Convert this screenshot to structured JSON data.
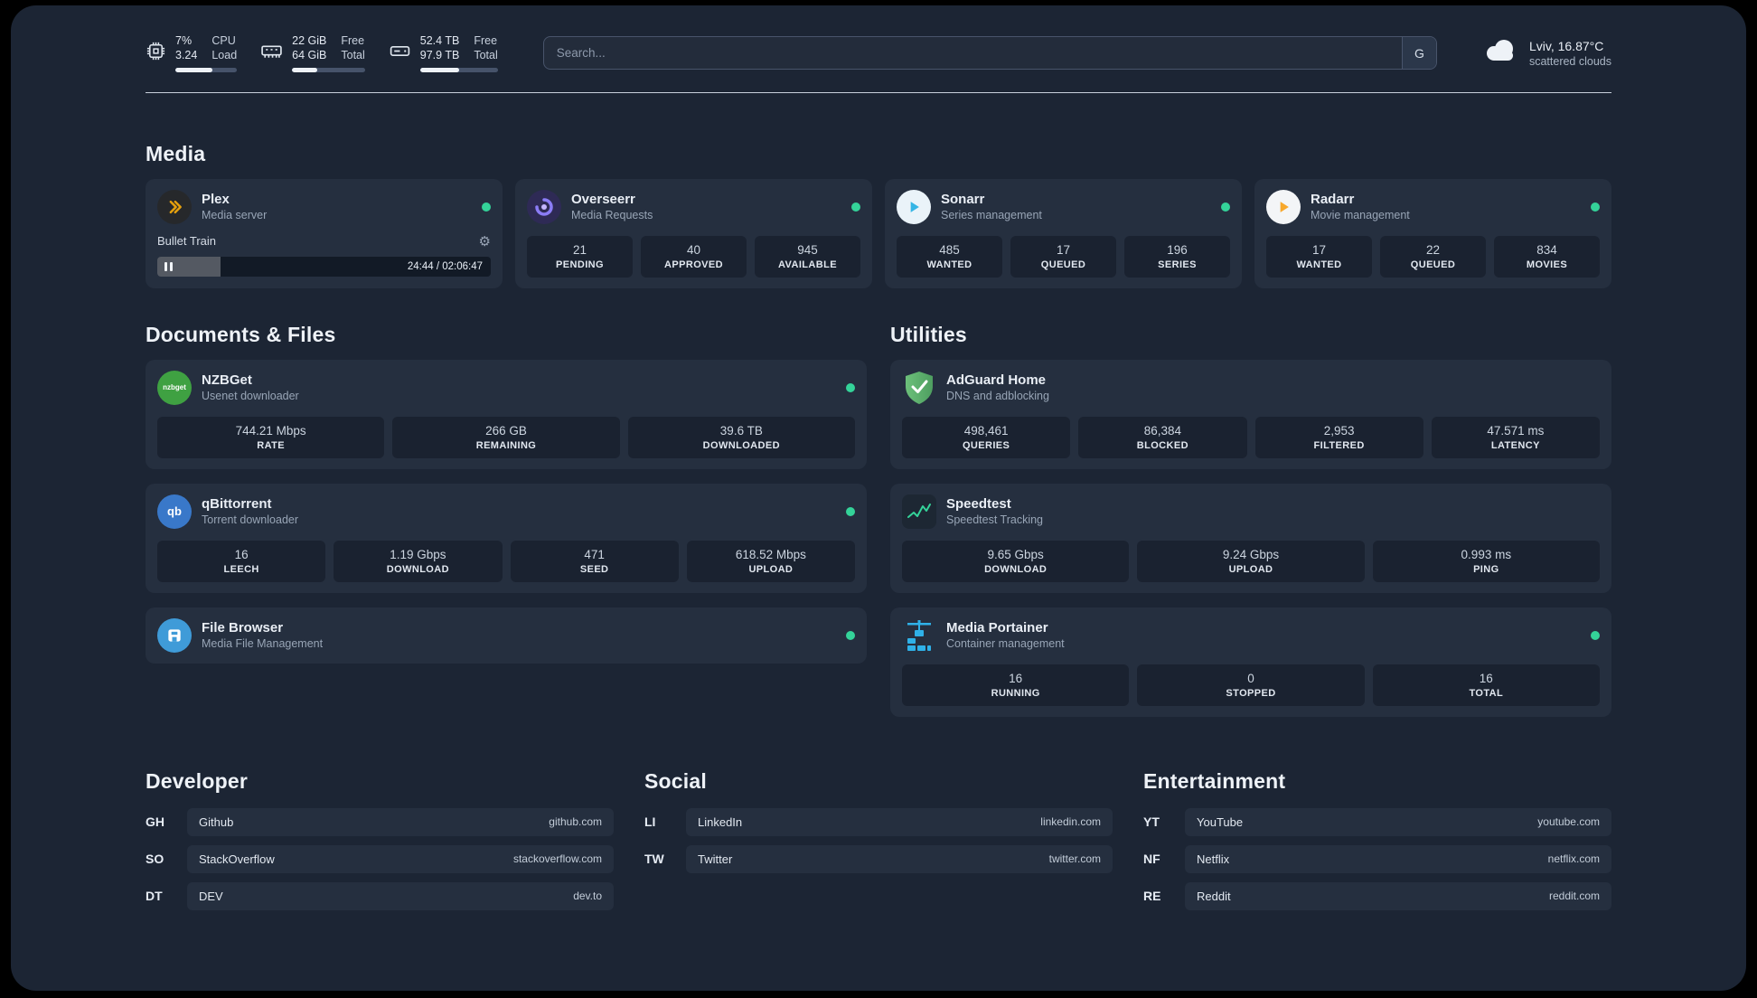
{
  "topbar": {
    "cpu": {
      "percent": "7%",
      "load": "3.24",
      "label_top": "CPU",
      "label_bottom": "Load",
      "bar_pct": 60
    },
    "ram": {
      "free": "22 GiB",
      "total": "64 GiB",
      "free_label": "Free",
      "total_label": "Total",
      "bar_pct": 35
    },
    "disk": {
      "free": "52.4 TB",
      "total": "97.9 TB",
      "free_label": "Free",
      "total_label": "Total",
      "bar_pct": 50
    },
    "search": {
      "placeholder": "Search...",
      "provider_letter": "G"
    },
    "weather": {
      "location": "Lviv, 16.87°C",
      "condition": "scattered clouds"
    }
  },
  "sections": {
    "media": {
      "title": "Media",
      "cards": {
        "plex": {
          "name": "Plex",
          "subtitle": "Media server",
          "now_playing": "Bullet Train",
          "time": "24:44 / 02:06:47",
          "progress_pct": 19
        },
        "overseerr": {
          "name": "Overseerr",
          "subtitle": "Media Requests",
          "stats": [
            {
              "value": "21",
              "label": "PENDING"
            },
            {
              "value": "40",
              "label": "APPROVED"
            },
            {
              "value": "945",
              "label": "AVAILABLE"
            }
          ]
        },
        "sonarr": {
          "name": "Sonarr",
          "subtitle": "Series management",
          "stats": [
            {
              "value": "485",
              "label": "WANTED"
            },
            {
              "value": "17",
              "label": "QUEUED"
            },
            {
              "value": "196",
              "label": "SERIES"
            }
          ]
        },
        "radarr": {
          "name": "Radarr",
          "subtitle": "Movie management",
          "stats": [
            {
              "value": "17",
              "label": "WANTED"
            },
            {
              "value": "22",
              "label": "QUEUED"
            },
            {
              "value": "834",
              "label": "MOVIES"
            }
          ]
        }
      }
    },
    "documents": {
      "title": "Documents & Files",
      "cards": {
        "nzbget": {
          "name": "NZBGet",
          "subtitle": "Usenet downloader",
          "icon_text": "nzbget",
          "stats": [
            {
              "value": "744.21 Mbps",
              "label": "RATE"
            },
            {
              "value": "266 GB",
              "label": "REMAINING"
            },
            {
              "value": "39.6 TB",
              "label": "DOWNLOADED"
            }
          ]
        },
        "qbittorrent": {
          "name": "qBittorrent",
          "subtitle": "Torrent downloader",
          "icon_text": "qb",
          "stats": [
            {
              "value": "16",
              "label": "LEECH"
            },
            {
              "value": "1.19 Gbps",
              "label": "DOWNLOAD"
            },
            {
              "value": "471",
              "label": "SEED"
            },
            {
              "value": "618.52 Mbps",
              "label": "UPLOAD"
            }
          ]
        },
        "filebrowser": {
          "name": "File Browser",
          "subtitle": "Media File Management"
        }
      }
    },
    "utilities": {
      "title": "Utilities",
      "cards": {
        "adguard": {
          "name": "AdGuard Home",
          "subtitle": "DNS and adblocking",
          "stats": [
            {
              "value": "498,461",
              "label": "QUERIES"
            },
            {
              "value": "86,384",
              "label": "BLOCKED"
            },
            {
              "value": "2,953",
              "label": "FILTERED"
            },
            {
              "value": "47.571 ms",
              "label": "LATENCY"
            }
          ]
        },
        "speedtest": {
          "name": "Speedtest",
          "subtitle": "Speedtest Tracking",
          "stats": [
            {
              "value": "9.65 Gbps",
              "label": "DOWNLOAD"
            },
            {
              "value": "9.24 Gbps",
              "label": "UPLOAD"
            },
            {
              "value": "0.993 ms",
              "label": "PING"
            }
          ]
        },
        "portainer": {
          "name": "Media Portainer",
          "subtitle": "Container management",
          "stats": [
            {
              "value": "16",
              "label": "RUNNING"
            },
            {
              "value": "0",
              "label": "STOPPED"
            },
            {
              "value": "16",
              "label": "TOTAL"
            }
          ]
        }
      }
    }
  },
  "bookmarks": {
    "developer": {
      "title": "Developer",
      "items": [
        {
          "abbr": "GH",
          "name": "Github",
          "url": "github.com"
        },
        {
          "abbr": "SO",
          "name": "StackOverflow",
          "url": "stackoverflow.com"
        },
        {
          "abbr": "DT",
          "name": "DEV",
          "url": "dev.to"
        }
      ]
    },
    "social": {
      "title": "Social",
      "items": [
        {
          "abbr": "LI",
          "name": "LinkedIn",
          "url": "linkedin.com"
        },
        {
          "abbr": "TW",
          "name": "Twitter",
          "url": "twitter.com"
        }
      ]
    },
    "entertainment": {
      "title": "Entertainment",
      "items": [
        {
          "abbr": "YT",
          "name": "YouTube",
          "url": "youtube.com"
        },
        {
          "abbr": "NF",
          "name": "Netflix",
          "url": "netflix.com"
        },
        {
          "abbr": "RE",
          "name": "Reddit",
          "url": "reddit.com"
        }
      ]
    }
  },
  "colors": {
    "status_online": "#34d399",
    "background": "#1c2534",
    "card": "#252f3f",
    "stat_box": "#1a2230",
    "plex_accent": "#e5a00d"
  }
}
